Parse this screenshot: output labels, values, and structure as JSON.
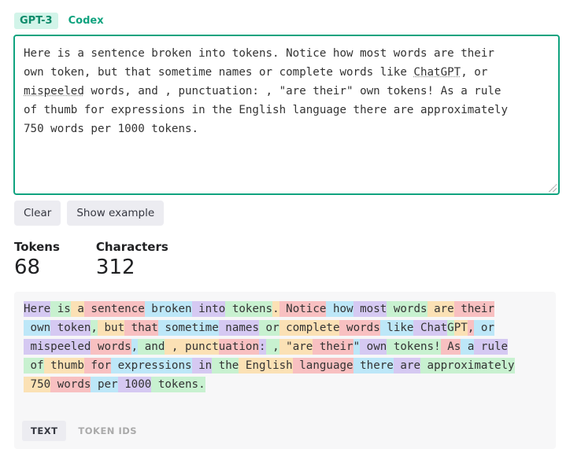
{
  "model_tabs": [
    {
      "label": "GPT-3",
      "active": true
    },
    {
      "label": "Codex",
      "active": false
    }
  ],
  "input": {
    "text_before": "Here is a sentence broken into tokens. Notice how most words are their\nown token, but that sometime names or complete words like ",
    "u1": "ChatGPT",
    "text_mid": ", or\n",
    "u2": "mispeeled",
    "text_after": " words, and , punctuation: , \"are their\" own tokens! As a rule\nof thumb for expressions in the English language there are approximately\n750 words per 1000 tokens."
  },
  "buttons": {
    "clear": "Clear",
    "show_example": "Show example"
  },
  "stats": {
    "tokens_label": "Tokens",
    "tokens_value": "68",
    "characters_label": "Characters",
    "characters_value": "312"
  },
  "colors": {
    "P": "#d5c9f2",
    "G": "#c8f1d0",
    "O": "#fbe1b5",
    "R": "#f8c0c1",
    "B": "#bde7f8",
    "accent": "#10a37f"
  },
  "tokens": [
    [
      "Here",
      "P"
    ],
    [
      " is",
      "G"
    ],
    [
      " a",
      "O"
    ],
    [
      " sentence",
      "R"
    ],
    [
      " broken",
      "B"
    ],
    [
      " into",
      "P"
    ],
    [
      " tokens",
      "G"
    ],
    [
      ".",
      "O"
    ],
    [
      " Notice",
      "R"
    ],
    [
      " how",
      "B"
    ],
    [
      " most",
      "P"
    ],
    [
      " words",
      "G"
    ],
    [
      " are",
      "O"
    ],
    [
      " their",
      "R"
    ],
    [
      "\n",
      "B"
    ],
    [
      " own",
      "B"
    ],
    [
      " token",
      "P"
    ],
    [
      ",",
      "G"
    ],
    [
      " but",
      "O"
    ],
    [
      " that",
      "R"
    ],
    [
      " sometime",
      "B"
    ],
    [
      " names",
      "P"
    ],
    [
      " or",
      "G"
    ],
    [
      " complete",
      "O"
    ],
    [
      " words",
      "R"
    ],
    [
      " like",
      "B"
    ],
    [
      " Chat",
      "P"
    ],
    [
      "G",
      "G"
    ],
    [
      "PT",
      "O"
    ],
    [
      ",",
      "R"
    ],
    [
      " or",
      "B"
    ],
    [
      "\n",
      "P"
    ],
    [
      " mis",
      "P"
    ],
    [
      "peeled",
      "P"
    ],
    [
      " words",
      "R"
    ],
    [
      ",",
      "B"
    ],
    [
      " and",
      "G"
    ],
    [
      " ,",
      "O"
    ],
    [
      " punct",
      "O"
    ],
    [
      "uation",
      "R"
    ],
    [
      ":",
      "P"
    ],
    [
      " ,",
      "G"
    ],
    [
      " \"",
      "O"
    ],
    [
      "are",
      "O"
    ],
    [
      " their",
      "R"
    ],
    [
      "\"",
      "B"
    ],
    [
      " own",
      "P"
    ],
    [
      " tokens",
      "G"
    ],
    [
      "!",
      "G"
    ],
    [
      " As",
      "R"
    ],
    [
      " a",
      "B"
    ],
    [
      " rule",
      "P"
    ],
    [
      "\n",
      "G"
    ],
    [
      " of",
      "G"
    ],
    [
      " thumb",
      "O"
    ],
    [
      " for",
      "R"
    ],
    [
      " expressions",
      "B"
    ],
    [
      " in",
      "P"
    ],
    [
      " the",
      "G"
    ],
    [
      " English",
      "O"
    ],
    [
      " language",
      "R"
    ],
    [
      " there",
      "B"
    ],
    [
      " are",
      "P"
    ],
    [
      " approximately",
      "G"
    ],
    [
      "\n",
      "O"
    ],
    [
      " 750",
      "O"
    ],
    [
      " words",
      "R"
    ],
    [
      " per",
      "B"
    ],
    [
      " 1000",
      "P"
    ],
    [
      " tokens",
      "G"
    ],
    [
      ".",
      "G"
    ]
  ],
  "view_tabs": [
    {
      "label": "TEXT",
      "active": true
    },
    {
      "label": "TOKEN IDS",
      "active": false
    }
  ]
}
